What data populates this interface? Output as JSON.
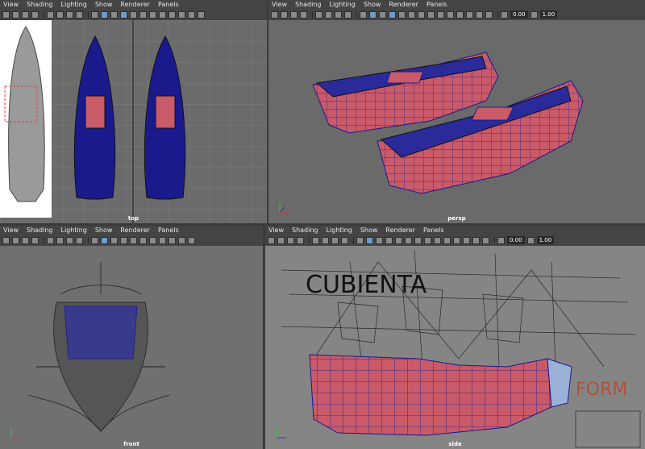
{
  "menus": [
    "View",
    "Shading",
    "Lighting",
    "Show",
    "Renderer",
    "Panels"
  ],
  "toolbar_fields": {
    "value_a": "0.00",
    "value_b": "1.00"
  },
  "panes": {
    "top": {
      "label": "top"
    },
    "persp": {
      "label": "persp"
    },
    "front": {
      "label": "front"
    },
    "side": {
      "label": "side"
    }
  },
  "sketch_text": "CUBIENTA",
  "side_text": "FORM",
  "colors": {
    "hull": "#c95a6a",
    "wire": "#1a1a8c",
    "grid": "#888888",
    "active_border": "#8fb6de"
  }
}
